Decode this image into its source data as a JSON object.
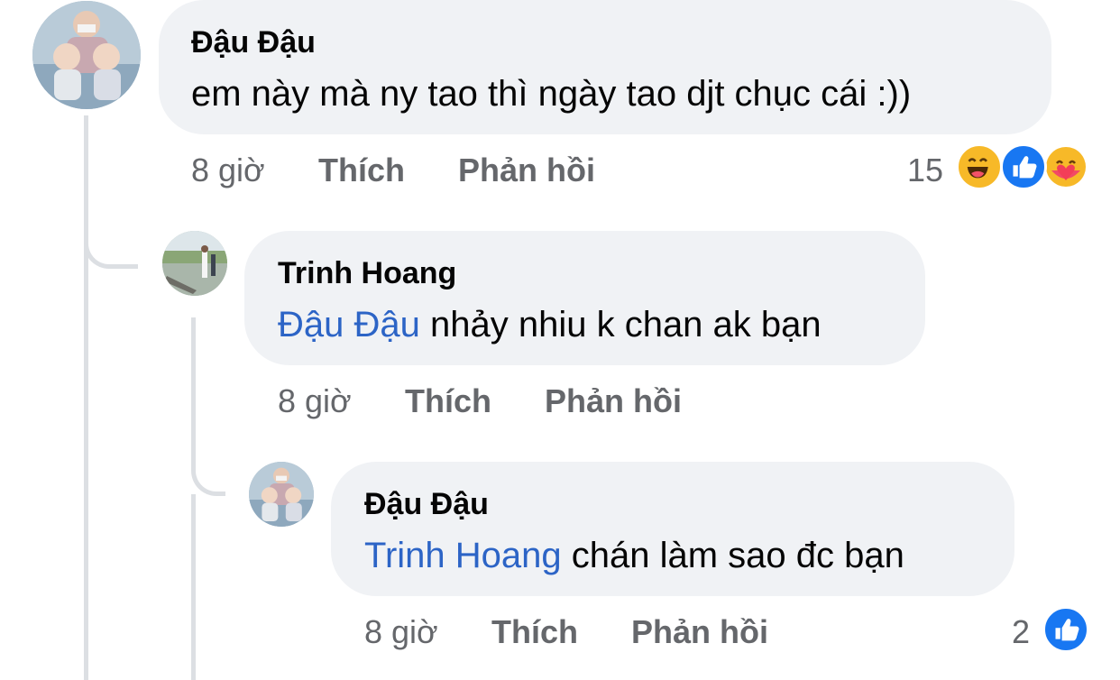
{
  "comments": [
    {
      "author": "Đậu Đậu",
      "mention": "",
      "text": "em này mà ny tao thì ngày tao djt chục cái :))",
      "time": "8 giờ",
      "like_label": "Thích",
      "reply_label": "Phản hồi",
      "reaction_count": "15",
      "reactions": [
        "haha-icon",
        "like-icon",
        "care-icon"
      ]
    },
    {
      "author": "Trinh Hoang",
      "mention": "Đậu Đậu",
      "text": " nhảy nhiu k chan ak bạn",
      "time": "8 giờ",
      "like_label": "Thích",
      "reply_label": "Phản hồi"
    },
    {
      "author": "Đậu Đậu",
      "mention": "Trinh Hoang",
      "text": " chán làm sao đc bạn",
      "time": "8 giờ",
      "like_label": "Thích",
      "reply_label": "Phản hồi",
      "reaction_count": "2",
      "reactions": [
        "like-icon"
      ]
    }
  ],
  "colors": {
    "bubble": "#f0f2f5",
    "mention": "#2c64c6",
    "meta": "#65676b",
    "thread_line": "#dcdfe3",
    "like_blue": "#1877f2",
    "haha_yellow": "#f7b928"
  }
}
